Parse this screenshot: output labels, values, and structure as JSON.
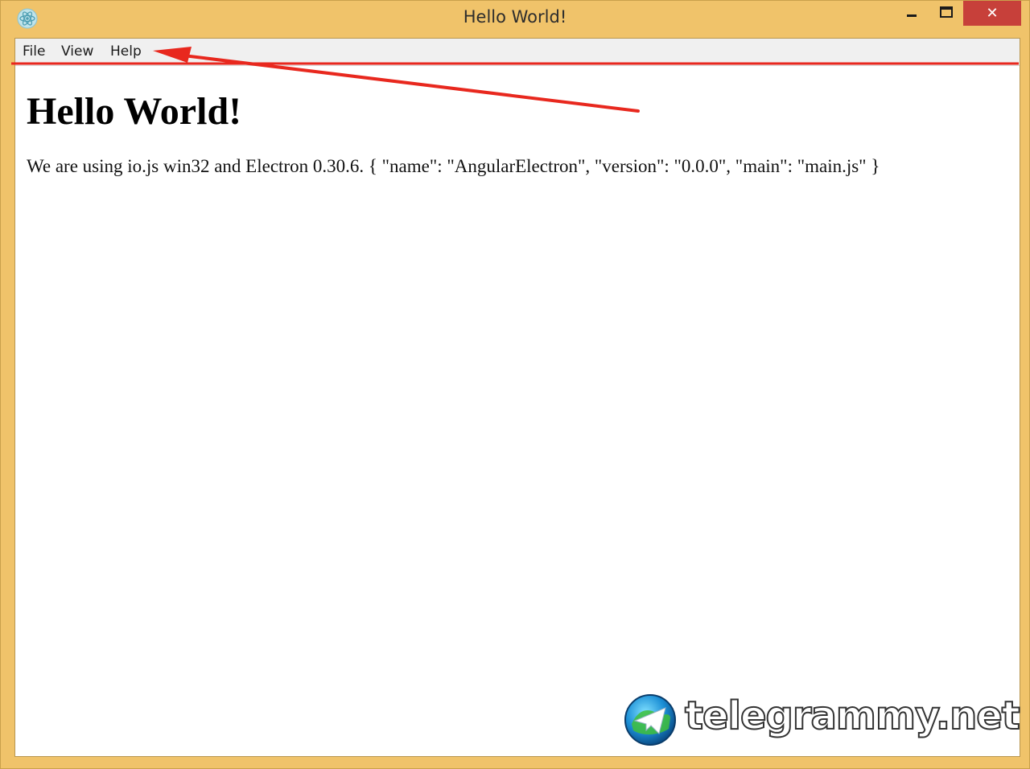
{
  "window": {
    "title": "Hello World!",
    "icon": "electron-icon",
    "controls": {
      "minimize_icon": "minimize-icon",
      "maximize_icon": "maximize-icon",
      "close_icon": "close-icon",
      "close_glyph": "✕"
    },
    "frame_color": "#f0c36a",
    "close_color": "#c7403a"
  },
  "menubar": {
    "items": [
      {
        "label": "File"
      },
      {
        "label": "View"
      },
      {
        "label": "Help"
      }
    ]
  },
  "content": {
    "heading": "Hello World!",
    "body": "We are using io.js win32 and Electron 0.30.6. { \"name\": \"AngularElectron\", \"version\": \"0.0.0\", \"main\": \"main.js\" }"
  },
  "annotation": {
    "color": "#e8281e"
  },
  "watermark": {
    "text": "telegrammy.net",
    "icon": "telegram-globe-icon"
  }
}
